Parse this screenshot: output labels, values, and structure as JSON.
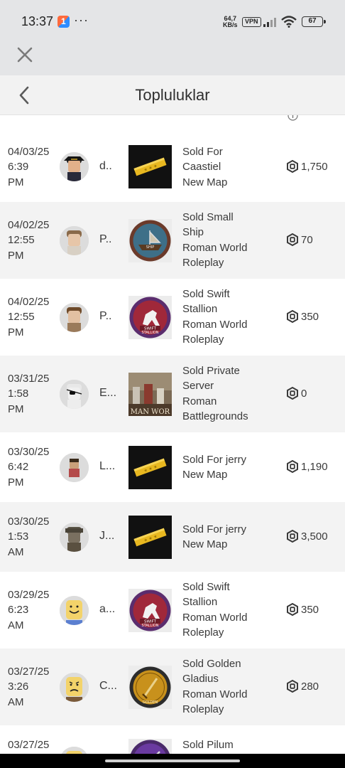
{
  "status_bar": {
    "time": "13:37",
    "more": "···",
    "net_speed_value": "64,7",
    "net_speed_unit": "KB/s",
    "vpn": "VPN",
    "battery": "67"
  },
  "header": {
    "title": "Topluluklar"
  },
  "colors": {
    "status_bg": "#e4e5e7",
    "row_alt_bg": "#f3f3f3",
    "text": "#3a3a3a"
  },
  "transactions": [
    {
      "date": [
        "04/03/25",
        "6:39",
        "PM"
      ],
      "user": "d..",
      "desc": [
        "Sold For",
        "Caastiel",
        "New Map"
      ],
      "price": "1,750",
      "thumb": "gold-pass",
      "avatar": "pirate"
    },
    {
      "date": [
        "04/02/25",
        "12:55",
        "PM"
      ],
      "user": "P..",
      "desc": [
        "Sold Small",
        "Ship",
        "Roman World",
        "Roleplay"
      ],
      "price": "70",
      "thumb": "ship-badge",
      "avatar": "helmet-girl"
    },
    {
      "date": [
        "04/02/25",
        "12:55",
        "PM"
      ],
      "user": "P..",
      "desc": [
        "Sold Swift",
        "Stallion",
        "Roman World",
        "Roleplay"
      ],
      "price": "350",
      "thumb": "stallion-badge",
      "avatar": "brown-hair"
    },
    {
      "date": [
        "03/31/25",
        "1:58",
        "PM"
      ],
      "user": "E...",
      "desc": [
        "Sold Private",
        "Server",
        "Roman",
        "Battlegrounds"
      ],
      "price": "0",
      "thumb": "battlegrounds",
      "avatar": "eyepatch"
    },
    {
      "date": [
        "03/30/25",
        "6:42",
        "PM"
      ],
      "user": "L...",
      "desc": [
        "Sold For jerry",
        "New Map"
      ],
      "price": "1,190",
      "thumb": "gold-pass",
      "avatar": "small-figure"
    },
    {
      "date": [
        "03/30/25",
        "1:53",
        "AM"
      ],
      "user": "J...",
      "desc": [
        "Sold For jerry",
        "New Map"
      ],
      "price": "3,500",
      "thumb": "gold-pass",
      "avatar": "soldier"
    },
    {
      "date": [
        "03/29/25",
        "6:23",
        "AM"
      ],
      "user": "a...",
      "desc": [
        "Sold Swift",
        "Stallion",
        "Roman World",
        "Roleplay"
      ],
      "price": "350",
      "thumb": "stallion-badge",
      "avatar": "smile"
    },
    {
      "date": [
        "03/27/25",
        "3:26",
        "AM"
      ],
      "user": "C...",
      "desc": [
        "Sold Golden",
        "Gladius",
        "Roman World",
        "Roleplay"
      ],
      "price": "280",
      "thumb": "gladius-badge",
      "avatar": "frown"
    },
    {
      "date": [
        "03/27/25",
        "",
        ""
      ],
      "user": "",
      "desc": [
        "Sold Pilum",
        "",
        "",
        ""
      ],
      "price": "",
      "thumb": "pilum-badge",
      "avatar": "frown"
    }
  ]
}
